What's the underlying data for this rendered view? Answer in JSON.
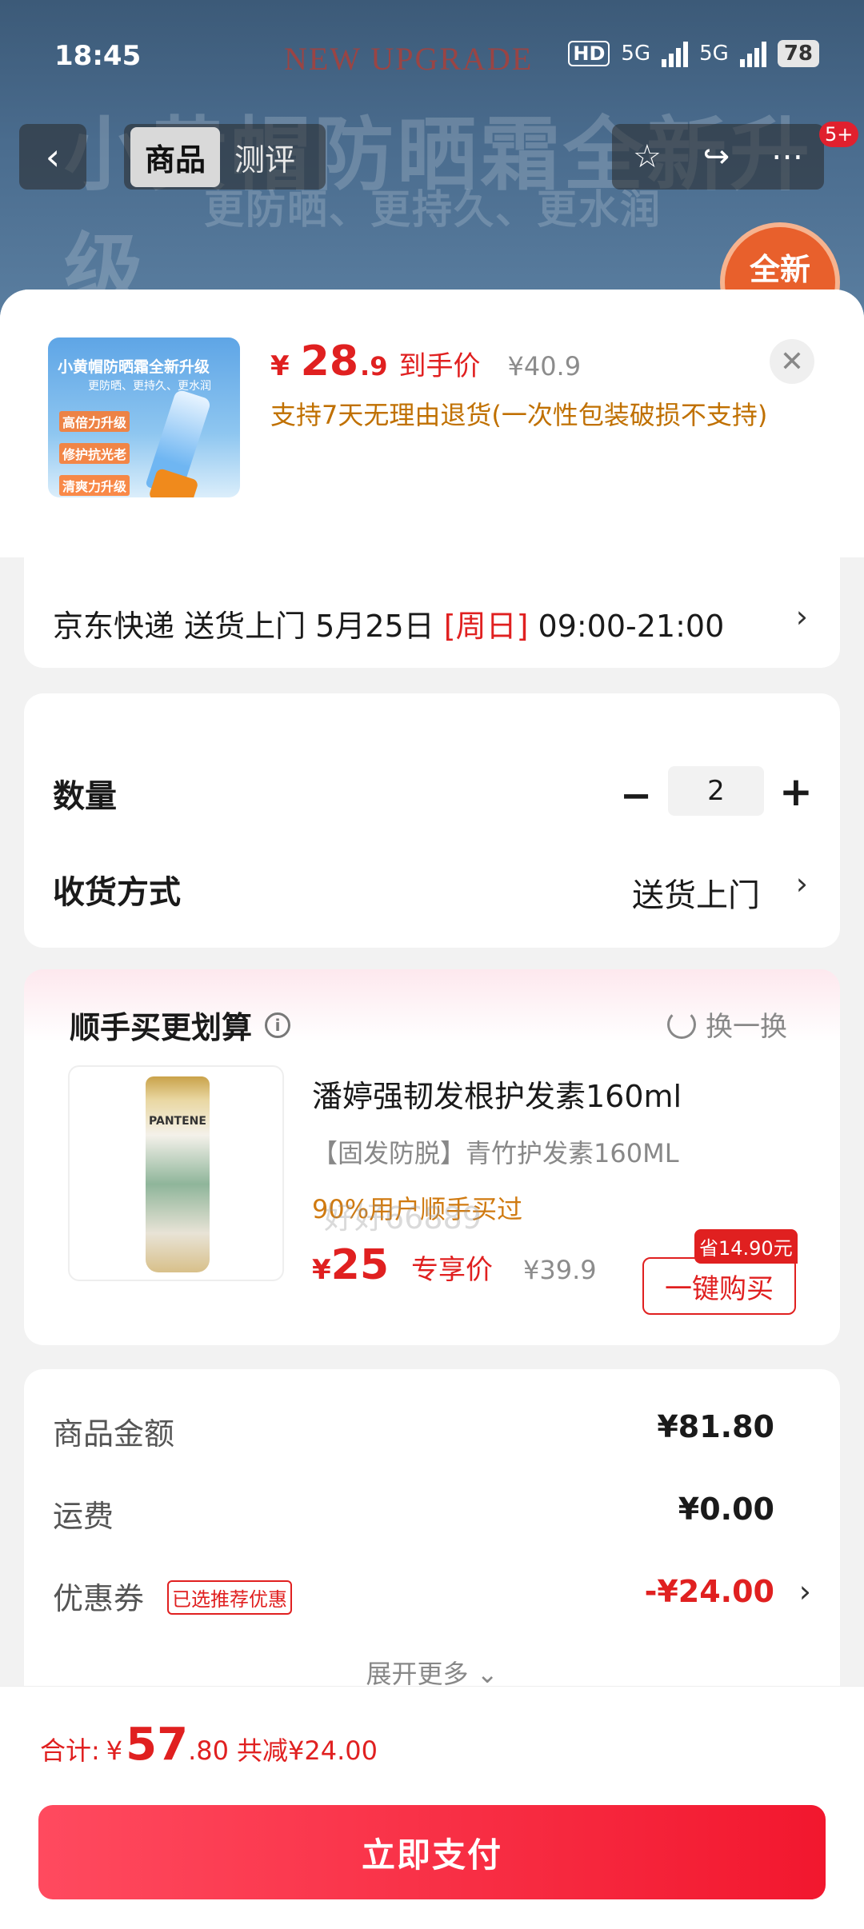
{
  "status_bar": {
    "time": "18:45",
    "hd": "HD",
    "net1": "5G",
    "net2": "5G",
    "battery": "78"
  },
  "banner": {
    "upgrade_text": "NEW UPGRADE",
    "title": "小黄帽防晒霜全新升级",
    "subtitle": "更防晒、更持久、更水润",
    "badge": "全新"
  },
  "header": {
    "back_icon": "back-arrow-icon",
    "tab_active": "商品",
    "tab_inactive": "测评",
    "notif_count": "5+"
  },
  "product": {
    "thumb_title": "小黄帽防晒霜全新升级",
    "thumb_sub": "更防晒、更持久、更水润",
    "thumb_lines": [
      "高倍力升级",
      "修护抗光老",
      "清爽力升级"
    ],
    "price_symbol": "¥",
    "price_int": "28",
    "price_dec": ".9",
    "price_label": "到手价",
    "original_price": "¥40.9",
    "return_note": "支持7天无理由退货(一次性包装破损不支持)"
  },
  "delivery": {
    "prefix": "京东快递 送货上门 5月25日 ",
    "weekday": "[周日]",
    "time": " 09:00-21:00"
  },
  "options": {
    "qty_label": "数量",
    "qty_value": "2",
    "ship_label": "收货方式",
    "ship_value": "送货上门"
  },
  "watermark": "好好66889",
  "addon": {
    "title": "顺手买更划算",
    "swap": "换一换",
    "name": "潘婷强韧发根护发素160ml",
    "desc": "【固发防脱】青竹护发素160ML",
    "bought": "90%用户顺手买过",
    "price_symbol": "¥",
    "price_int": "25",
    "price_label": "专享价",
    "original_price": "¥39.9",
    "save_tag": "省14.90元",
    "buy_label": "一键购买",
    "bottle_brand": "PANTENE"
  },
  "summary": {
    "goods_label": "商品金额",
    "goods_value": "¥81.80",
    "freight_label": "运费",
    "freight_value": "¥0.00",
    "coupon_label": "优惠券",
    "coupon_tag": "已选推荐优惠",
    "coupon_value": "-¥24.00",
    "expand": "展开更多"
  },
  "footer": {
    "total_label": "合计:",
    "total_symbol": "¥",
    "total_int": "57",
    "total_dec": ".80",
    "reduce": "共减¥24.00",
    "pay_label": "立即支付"
  },
  "colors": {
    "accent": "#e02020",
    "pay_button": "#f2172e",
    "gold": "#c07000"
  }
}
